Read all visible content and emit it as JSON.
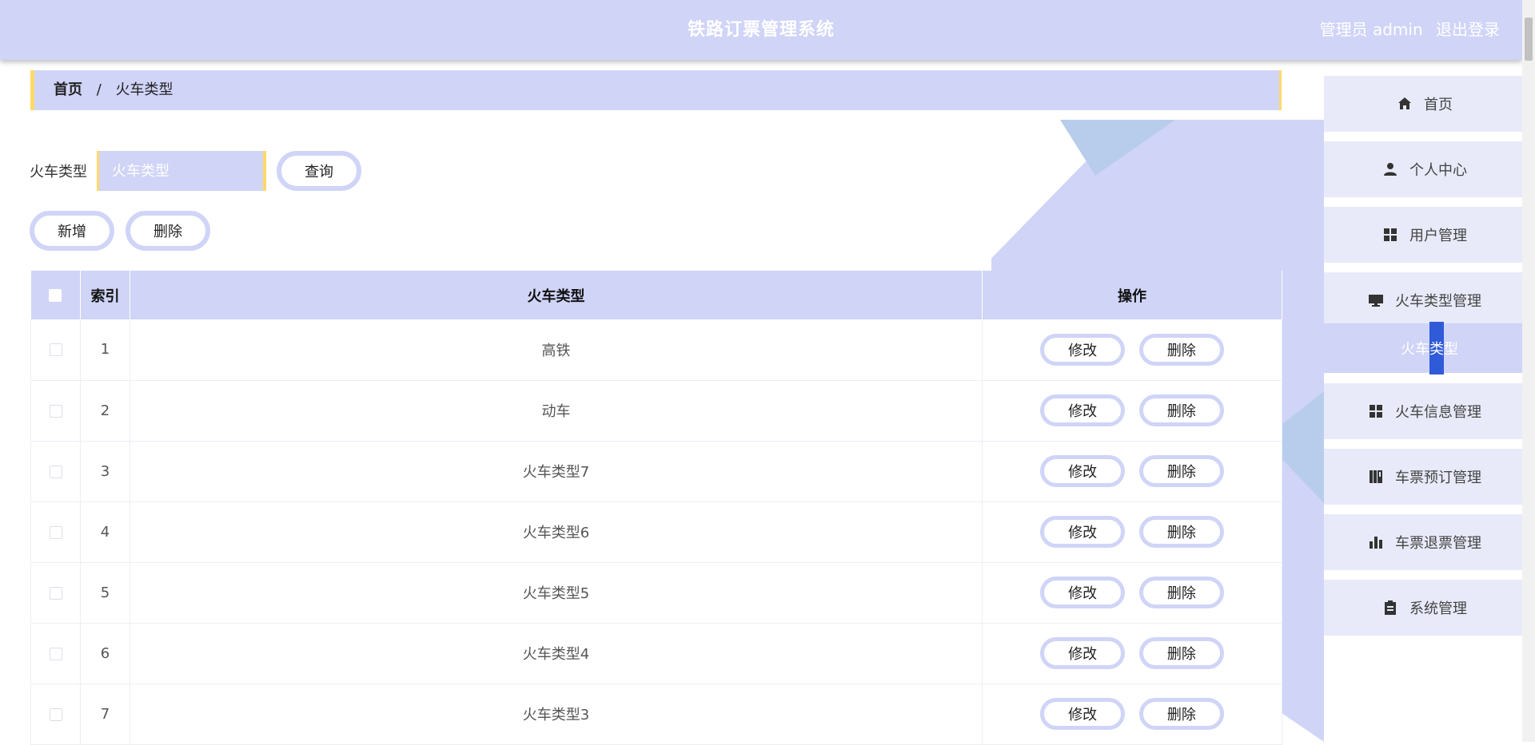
{
  "header": {
    "title": "铁路订票管理系统",
    "user_label": "管理员 admin",
    "logout_label": "退出登录"
  },
  "breadcrumb": {
    "home": "首页",
    "separator": "/",
    "current": "火车类型"
  },
  "search": {
    "label": "火车类型",
    "placeholder": "火车类型",
    "button_label": "查询"
  },
  "actions": {
    "add_label": "新增",
    "delete_label": "删除"
  },
  "table": {
    "columns": [
      "索引",
      "火车类型",
      "操作"
    ],
    "edit_label": "修改",
    "delete_label": "删除",
    "rows": [
      {
        "index": "1",
        "type": "高铁"
      },
      {
        "index": "2",
        "type": "动车"
      },
      {
        "index": "3",
        "type": "火车类型7"
      },
      {
        "index": "4",
        "type": "火车类型6"
      },
      {
        "index": "5",
        "type": "火车类型5"
      },
      {
        "index": "6",
        "type": "火车类型4"
      },
      {
        "index": "7",
        "type": "火车类型3"
      }
    ]
  },
  "sidebar": {
    "items": [
      {
        "label": "首页",
        "icon": "home-icon"
      },
      {
        "label": "个人中心",
        "icon": "user-icon"
      },
      {
        "label": "用户管理",
        "icon": "grid-icon"
      },
      {
        "label": "火车类型管理",
        "icon": "monitor-icon"
      },
      {
        "label": "火车信息管理",
        "icon": "grid-icon"
      },
      {
        "label": "车票预订管理",
        "icon": "book-icon"
      },
      {
        "label": "车票退票管理",
        "icon": "bar-chart-icon"
      },
      {
        "label": "系统管理",
        "icon": "clipboard-icon"
      }
    ],
    "active_sub": {
      "label_prefix": "火车",
      "label_highlight": "类",
      "label_suffix": "型"
    }
  },
  "colors": {
    "primary": "#d0d4f7",
    "accent_border": "#ffd966",
    "sidebar_bg": "#e8eaf9",
    "highlight": "#2f5bd8"
  }
}
